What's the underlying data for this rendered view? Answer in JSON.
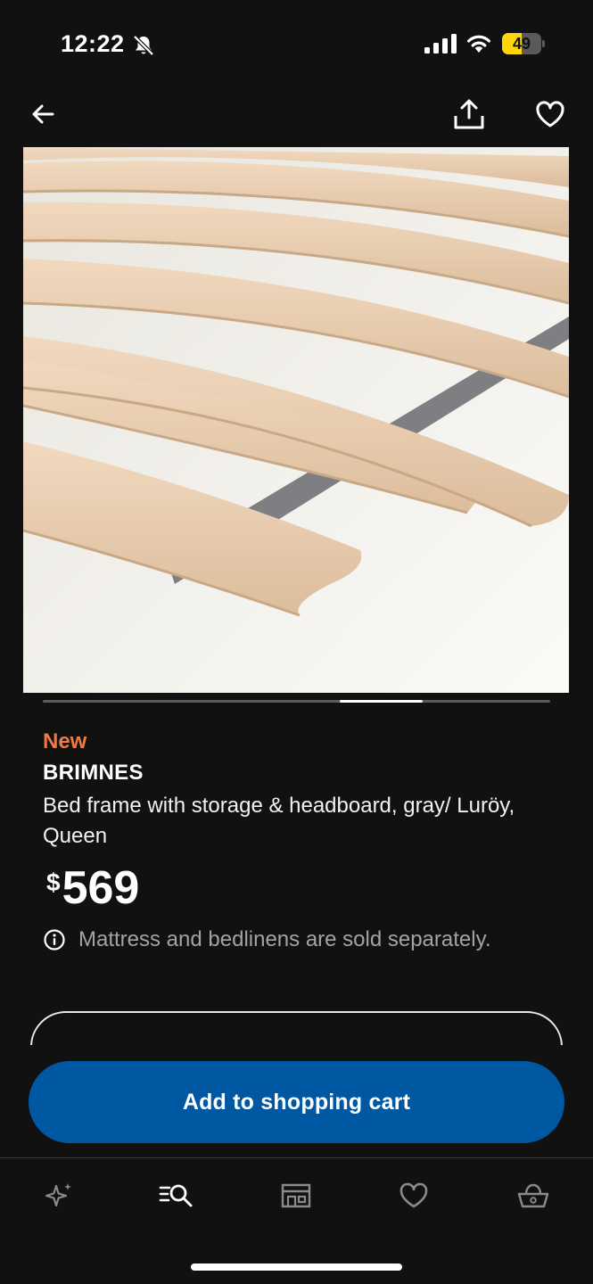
{
  "status_bar": {
    "time": "12:22",
    "battery_level": "49",
    "icons": [
      "bell-off-icon",
      "cellular-signal-icon",
      "wifi-icon",
      "battery-icon"
    ]
  },
  "top_nav": {
    "icons": [
      "arrow-left-icon",
      "share-icon",
      "heart-icon"
    ]
  },
  "product": {
    "badge": "New",
    "name": "BRIMNES",
    "description": "Bed frame with storage & headboard, gray/ Luröy, Queen",
    "price_currency": "$",
    "price_amount": "569",
    "notice": "Mattress and bedlinens are sold separately.",
    "image_alt": "wooden-slat-bed-base"
  },
  "carousel": {
    "current_fraction": 0.7
  },
  "actions": {
    "add_to_cart_label": "Add to shopping cart"
  },
  "bottom_nav": {
    "items": [
      "sparkle-icon",
      "search-list-icon",
      "store-icon",
      "heart-icon",
      "basket-icon"
    ],
    "active_index": 1
  },
  "colors": {
    "background": "#111111",
    "accent_new": "#ef7a45",
    "primary_button": "#0058a3",
    "battery_fill": "#ffd60a",
    "muted_text": "#a3a3a3"
  }
}
